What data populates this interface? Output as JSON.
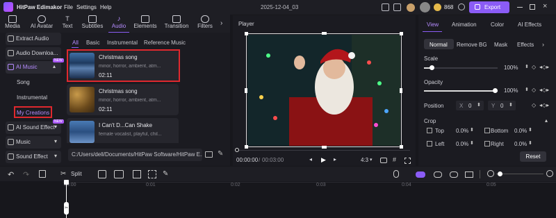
{
  "app": {
    "title": "HitPaw Edimakor",
    "date": "2025-12-04_03",
    "coins": "868",
    "export_label": "Export"
  },
  "menu": [
    "File",
    "Settings",
    "Help"
  ],
  "tabs": [
    "Media",
    "AI Avatar",
    "Text",
    "Subtitles",
    "Audio",
    "Elements",
    "Transition",
    "Filters"
  ],
  "active_tab": "Audio",
  "left_nav": {
    "extract_audio": "Extract Audio",
    "audio_download": "Audio Downloa...",
    "ai_music": "AI Music",
    "new_badge": "NEW",
    "song": "Song",
    "instrumental": "Instrumental",
    "my_creations": "My Creations",
    "ai_sound_effect": "AI Sound Effect",
    "music": "Music",
    "sound_effect": "Sound Effect"
  },
  "sub_tabs": [
    "All",
    "Basic",
    "Instrumental",
    "Reference Music"
  ],
  "songs": [
    {
      "title": "Christmas song",
      "desc": "minor, horror, ambient, atm...",
      "duration": "02:11"
    },
    {
      "title": "Christmas song",
      "desc": "minor, horror, ambient, atm...",
      "duration": "02:11"
    },
    {
      "title": "I Can't D...Can Shake",
      "desc": "female vocalist, playful, chil...",
      "duration": ""
    }
  ],
  "path_field": "C:/Users/dell/Documents/HitPaw Software/HitPaw E...",
  "player": {
    "title": "Player",
    "time_current": "00:00:00",
    "time_total": "00:03:00",
    "ratio": "4:3"
  },
  "right_tabs": [
    "View",
    "Animation",
    "Color",
    "AI Effects"
  ],
  "sub_right_tabs": [
    "Normal",
    "Remove BG",
    "Mask",
    "Effects"
  ],
  "props": {
    "scale_label": "Scale",
    "scale_value": "100%",
    "scale_level": 0.1,
    "opacity_label": "Opacity",
    "opacity_value": "100%",
    "opacity_level": 1.0,
    "position_label": "Position",
    "x_label": "X",
    "x_value": "0",
    "y_label": "Y",
    "y_value": "0",
    "crop_label": "Crop",
    "top_label": "Top",
    "top_value": "0.0%",
    "bottom_label": "Bottom",
    "bottom_value": "0.0%",
    "left_label": "Left",
    "left_value": "0.0%",
    "right_label": "Right",
    "right_value": "0.0%",
    "reset_label": "Reset"
  },
  "timeline": {
    "split_label": "Split",
    "ruler": [
      "00:00",
      "0:01",
      "0:02",
      "0:03",
      "0:04",
      "0:05"
    ]
  },
  "colors": {
    "accent": "#8b5cf6",
    "highlight": "#e0282e",
    "active_text": "#b68cff"
  }
}
